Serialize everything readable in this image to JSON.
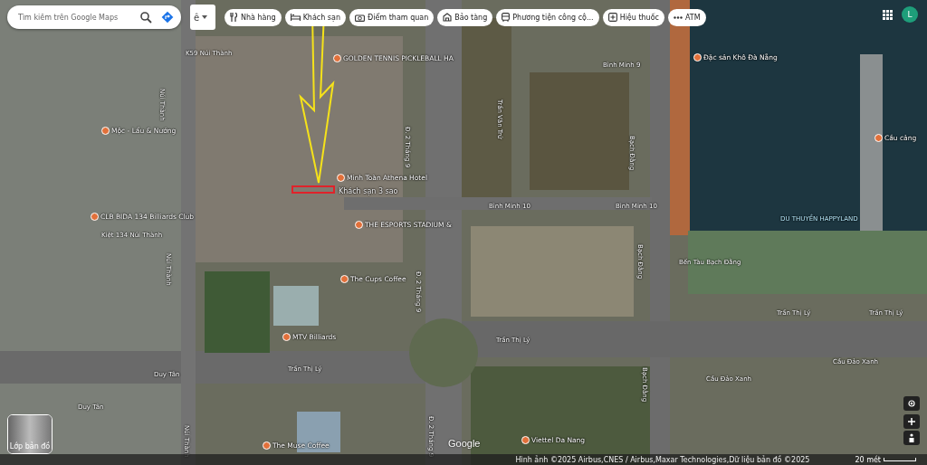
{
  "search": {
    "placeholder": "Tìm kiếm trên Google Maps"
  },
  "input_tool": {
    "label": "ê"
  },
  "filters": [
    {
      "label": "Nhà hàng",
      "kind": "restaurant"
    },
    {
      "label": "Khách sạn",
      "kind": "hotel"
    },
    {
      "label": "Điểm tham quan",
      "kind": "camera"
    },
    {
      "label": "Bảo tàng",
      "kind": "museum"
    },
    {
      "label": "Phương tiện công cộ...",
      "kind": "transit"
    },
    {
      "label": "Hiệu thuốc",
      "kind": "pharmacy"
    },
    {
      "label": "ATM",
      "kind": "more"
    }
  ],
  "account": {
    "initial": "L"
  },
  "map_labels": [
    {
      "text": "K59 Núi Thành",
      "kind": "street"
    },
    {
      "text": "GOLDEN TENNIS PICKLEBALL HA",
      "kind": "poi"
    },
    {
      "text": "Mộc - Lẩu & Nướng",
      "kind": "poi"
    },
    {
      "text": "Minh Toàn Athena Hotel",
      "kind": "poi"
    },
    {
      "text": "Khách sạn 3 sao",
      "kind": "note"
    },
    {
      "text": "THE ESPORTS STADIUM &",
      "kind": "poi"
    },
    {
      "text": "CLB BIDA 134 Billiards Club",
      "kind": "poi"
    },
    {
      "text": "Kiệt 134 Núi Thành",
      "kind": "street"
    },
    {
      "text": "The Cups Coffee",
      "kind": "poi"
    },
    {
      "text": "MTV Billiards",
      "kind": "poi"
    },
    {
      "text": "Núi Thành",
      "kind": "vstreet"
    },
    {
      "text": "Núi Thành",
      "kind": "vstreet"
    },
    {
      "text": "Núi Thành",
      "kind": "vstreet"
    },
    {
      "text": "Đ. 2 Tháng 9",
      "kind": "vstreet"
    },
    {
      "text": "Đ. 2 Tháng 9",
      "kind": "vstreet"
    },
    {
      "text": "Đ. 2 Tháng 9",
      "kind": "vstreet"
    },
    {
      "text": "Bình Minh 10",
      "kind": "street"
    },
    {
      "text": "Bình Minh 10",
      "kind": "street"
    },
    {
      "text": "Bình Minh 9",
      "kind": "street"
    },
    {
      "text": "Trần Văn Trứ",
      "kind": "vstreet"
    },
    {
      "text": "Bạch Đằng",
      "kind": "vstreet"
    },
    {
      "text": "Bạch Đằng",
      "kind": "vstreet"
    },
    {
      "text": "Bạch Đằng",
      "kind": "vstreet"
    },
    {
      "text": "Trần Thị Lý",
      "kind": "street"
    },
    {
      "text": "Trần Thị Lý",
      "kind": "street"
    },
    {
      "text": "Trần Thị Lý",
      "kind": "street"
    },
    {
      "text": "Trần Thị Lý",
      "kind": "street"
    },
    {
      "text": "Duy Tân",
      "kind": "street"
    },
    {
      "text": "Duy Tân",
      "kind": "street"
    },
    {
      "text": "Cầu Đảo Xanh",
      "kind": "street"
    },
    {
      "text": "Cầu Đảo Xanh",
      "kind": "street"
    },
    {
      "text": "Bến Tàu Bạch Đằng",
      "kind": "street"
    },
    {
      "text": "DU THUYỀN HAPPYLAND",
      "kind": "water"
    },
    {
      "text": "Đặc sản Khô Đà Nẵng",
      "kind": "poi"
    },
    {
      "text": "Cầu cảng",
      "kind": "poi"
    },
    {
      "text": "Viettel Da Nang",
      "kind": "poi"
    },
    {
      "text": "The Muse Coffee",
      "kind": "poi"
    }
  ],
  "layer_button": {
    "label": "Lớp bản đồ"
  },
  "logo": "Google",
  "attribution": "Hình ảnh ©2025 Airbus,CNES / Airbus,Maxar Technologies,Dữ liệu bản đồ ©2025",
  "scale": "20 mét"
}
